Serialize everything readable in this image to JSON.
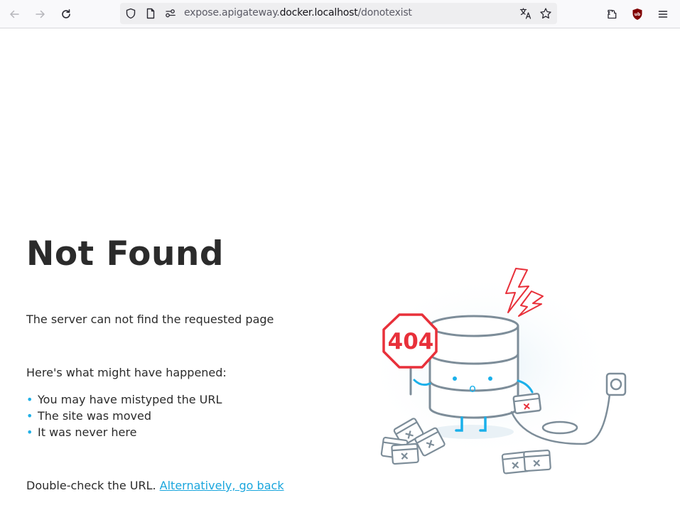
{
  "browser": {
    "url_prefix": "expose.apigateway.",
    "url_host": "docker.localhost",
    "url_path": "/donotexist",
    "icons": [
      "back-arrow-icon",
      "forward-arrow-icon",
      "reload-icon",
      "shield-icon",
      "page-icon",
      "permissions-icon",
      "translate-icon",
      "bookmark-star-icon",
      "extensions-icon",
      "ublock-icon",
      "menu-icon"
    ],
    "ublock_label": "ub"
  },
  "page": {
    "title": "Not Found",
    "subtitle": "The server can not find the requested page",
    "happened_heading": "Here's what might have happened:",
    "reasons": [
      "You may have mistyped the URL",
      "The site was moved",
      "It was never here"
    ],
    "bullet": "•",
    "footer_text": "Double-check the URL. ",
    "back_link": "Alternatively, go back"
  },
  "illustration": {
    "sign_text": "404",
    "face_text": "o",
    "accent_color": "#e8303a",
    "line_color": "#7d8d99",
    "eye_color": "#1ab0ea"
  },
  "colors": {
    "link": "#1aa6dd",
    "bullet": "#22b0e6",
    "text": "#2b2b2b"
  }
}
